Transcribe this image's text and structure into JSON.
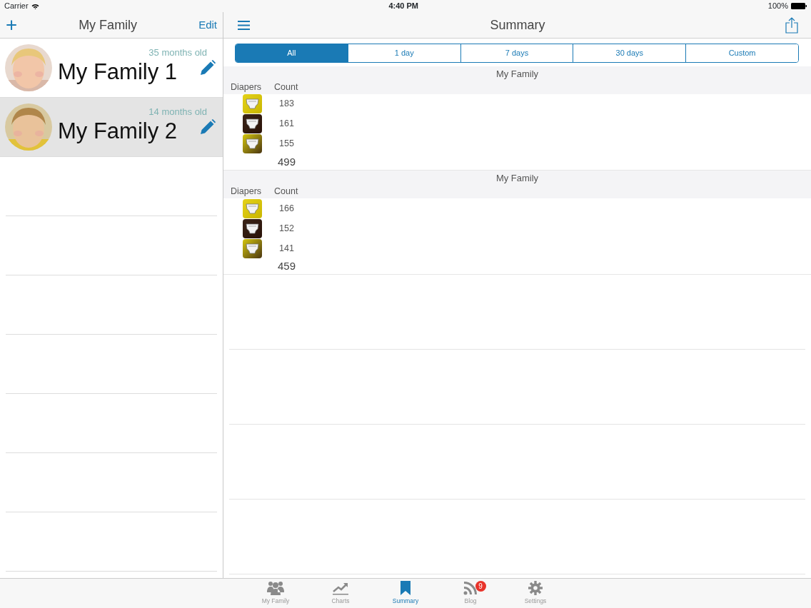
{
  "status_bar": {
    "carrier": "Carrier",
    "time": "4:40 PM",
    "battery": "100%"
  },
  "sidebar": {
    "title": "My Family",
    "edit": "Edit",
    "add": "+",
    "items": [
      {
        "name": "My Family 1",
        "age": "35 months old",
        "selected": false
      },
      {
        "name": "My Family 2",
        "age": "14 months old",
        "selected": true
      }
    ]
  },
  "main": {
    "title": "Summary",
    "segments": [
      {
        "label": "All",
        "selected": true
      },
      {
        "label": "1 day",
        "selected": false
      },
      {
        "label": "7 days",
        "selected": false
      },
      {
        "label": "30 days",
        "selected": false
      },
      {
        "label": "Custom",
        "selected": false
      }
    ],
    "sections": [
      {
        "title": "My Family",
        "columns": [
          "Diapers",
          "Count"
        ],
        "rows": [
          {
            "kind": "wet",
            "count": "183"
          },
          {
            "kind": "dirty",
            "count": "161"
          },
          {
            "kind": "mixed",
            "count": "155"
          }
        ],
        "total": "499"
      },
      {
        "title": "My Family",
        "columns": [
          "Diapers",
          "Count"
        ],
        "rows": [
          {
            "kind": "wet",
            "count": "166"
          },
          {
            "kind": "dirty",
            "count": "152"
          },
          {
            "kind": "mixed",
            "count": "141"
          }
        ],
        "total": "459"
      }
    ]
  },
  "tab_bar": [
    {
      "label": "My Family",
      "kind": "family",
      "selected": false
    },
    {
      "label": "Charts",
      "kind": "charts",
      "selected": false
    },
    {
      "label": "Summary",
      "kind": "summary",
      "selected": true
    },
    {
      "label": "Blog",
      "kind": "blog",
      "selected": false,
      "badge": "9"
    },
    {
      "label": "Settings",
      "kind": "settings",
      "selected": false
    }
  ]
}
